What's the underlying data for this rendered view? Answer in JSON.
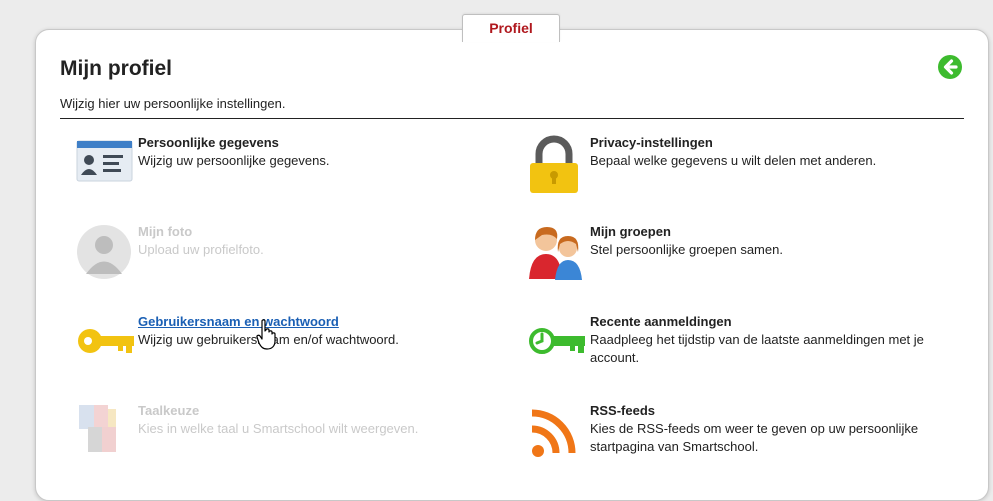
{
  "tab": {
    "label": "Profiel"
  },
  "header": {
    "title": "Mijn profiel",
    "subtitle": "Wijzig hier uw persoonlijke instellingen."
  },
  "items": [
    {
      "name": "Persoonlijke gegevens",
      "desc": "Wijzig uw persoonlijke gegevens.",
      "icon": "id-card-icon"
    },
    {
      "name": "Privacy-instellingen",
      "desc": "Bepaal welke gegevens u wilt delen met anderen.",
      "icon": "padlock-icon"
    },
    {
      "name": "Mijn foto",
      "desc": "Upload uw profielfoto.",
      "icon": "profile-photo-icon",
      "disabled": true
    },
    {
      "name": "Mijn groepen",
      "desc": "Stel persoonlijke groepen samen.",
      "icon": "group-people-icon"
    },
    {
      "name": "Gebruikersnaam en wachtwoord",
      "desc": "Wijzig uw gebruikersnaam en/of wachtwoord.",
      "icon": "key-icon",
      "hovered": true
    },
    {
      "name": "Recente aanmeldingen",
      "desc": "Raadpleeg het tijdstip van de laatste aanmeldingen met je account.",
      "icon": "clock-key-icon"
    },
    {
      "name": "Taalkeuze",
      "desc": "Kies in welke taal u Smartschool wilt weergeven.",
      "icon": "language-flags-icon",
      "disabled": true
    },
    {
      "name": "RSS-feeds",
      "desc": "Kies de RSS-feeds om weer te geven op uw persoonlijke startpagina van Smartschool.",
      "icon": "rss-icon"
    }
  ],
  "colors": {
    "tab_label": "#b0181e",
    "back_button": "#3dbb2e",
    "link": "#1a5fb4",
    "disabled_text": "#c9c9c9"
  }
}
